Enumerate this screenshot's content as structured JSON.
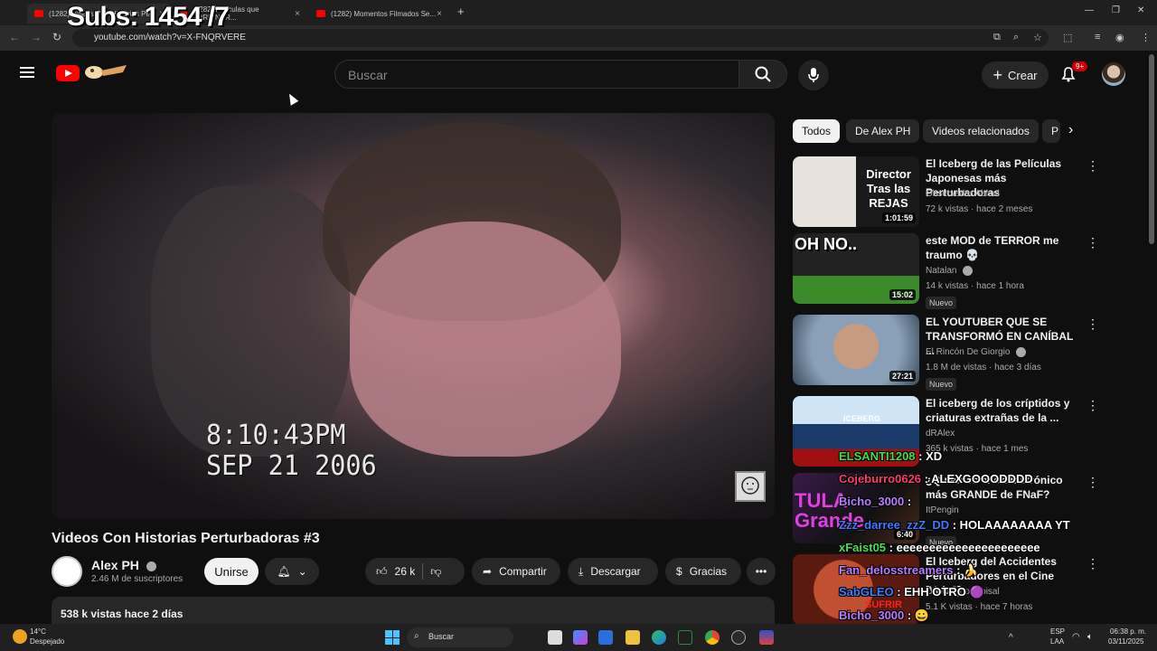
{
  "overlay": {
    "subs": "Subs: 1454 /7"
  },
  "browser": {
    "tabs": [
      {
        "label": "(1282) Videos Con Historias Pe..."
      },
      {
        "label": "(1282) Películas que ARRUINAR..."
      },
      {
        "label": "(1282) Momentos Filmados Se..."
      }
    ],
    "url": "youtube.com/watch?v=X-FNQRVERE"
  },
  "header": {
    "search_placeholder": "Buscar",
    "create_label": "Crear",
    "notif_count": "9+"
  },
  "video": {
    "timestamp_time": "8:10:43PM",
    "timestamp_date": "SEP 21 2006",
    "title": "Videos Con Historias Perturbadoras #3",
    "channel": "Alex PH",
    "subscribers": "2.46 M de suscriptores",
    "join_label": "Unirse",
    "likes": "26 k",
    "share_label": "Compartir",
    "download_label": "Descargar",
    "thanks_label": "Gracias",
    "views_date": "538 k vistas  hace 2 días"
  },
  "sidebar": {
    "chips": [
      "Todos",
      "De Alex PH",
      "Videos relacionados",
      "P"
    ],
    "recommendations": [
      {
        "title": "El Iceberg de las Películas Japonesas más Perturbadoras",
        "channel": "Observador Abisal",
        "meta": "72 k vistas · hace 2 meses",
        "duration": "1:01:59",
        "badge": "",
        "thumb_text": "Director Tras las REJAS"
      },
      {
        "title": "este MOD de TERROR me traumo 💀",
        "channel": "Natalan",
        "meta": "14 k vistas · hace 1 hora",
        "duration": "15:02",
        "badge": "Nuevo",
        "thumb_text": "OH NO.."
      },
      {
        "title": "EL YOUTUBER QUE SE TRANSFORMÓ EN CANÍBAL ...",
        "channel": "El Rincón De Giorgio",
        "meta": "1.8 M de vistas · hace 3 días",
        "duration": "27:21",
        "badge": "Nuevo",
        "thumb_text": ""
      },
      {
        "title": "El iceberg de los críptidos y criaturas extrañas de la ...",
        "channel": "dRAlex",
        "meta": "365 k vistas · hace 1 mes",
        "duration": "",
        "badge": "",
        "thumb_text": "ICEBERG"
      },
      {
        "title": "¿Quién es el Animatrónico más GRANDE de FNaF?",
        "channel": "ItPengin",
        "meta": "",
        "duration": "6:40",
        "badge": "Nuevo",
        "thumb_text": "TULA Grande"
      },
      {
        "title": "El Iceberg del Accidentes Perturbadores en el Cine [Vol. 2]",
        "channel": "Observador Abisal",
        "meta": "5.1 K vistas · hace 7 horas",
        "duration": "",
        "badge": "",
        "thumb_text": "SUFRIR"
      }
    ]
  },
  "chat": [
    {
      "user": "ELSANTI1208",
      "msg": " : XD",
      "color": "#3ee03e"
    },
    {
      "user": "Cojeburro0626",
      "msg": " : ALEXGOOODDDD",
      "color": "#ff3b6b"
    },
    {
      "user": "Bicho_3000",
      "msg": " : ",
      "color": "#b77cff"
    },
    {
      "user": "Zzz_darree_zzZ_DD",
      "msg": " : HOLAAAAAAAA YT",
      "color": "#3a7bff"
    },
    {
      "user": "xFaist05",
      "msg": " : eeeeeeeeeeeeeeeeeeeeee",
      "color": "#49e04a"
    },
    {
      "user": "Fan_delosstreamers",
      "msg": " : 🍌",
      "color": "#b77cff"
    },
    {
      "user": "SabGLEO",
      "msg": " : EHH OTRO 🟣",
      "color": "#3a7bff"
    },
    {
      "user": "Bicho_3000",
      "msg": " : 😀",
      "color": "#b77cff"
    },
    {
      "user": "Bicho_3000",
      "msg": " : 👾",
      "color": "#b77cff"
    }
  ],
  "taskbar": {
    "weather_temp": "14°C",
    "weather_desc": "Despejado",
    "search_label": "Buscar",
    "lang": "ESP",
    "lang2": "LAA",
    "time": "06:38 p. m.",
    "date": "03/11/2025"
  }
}
